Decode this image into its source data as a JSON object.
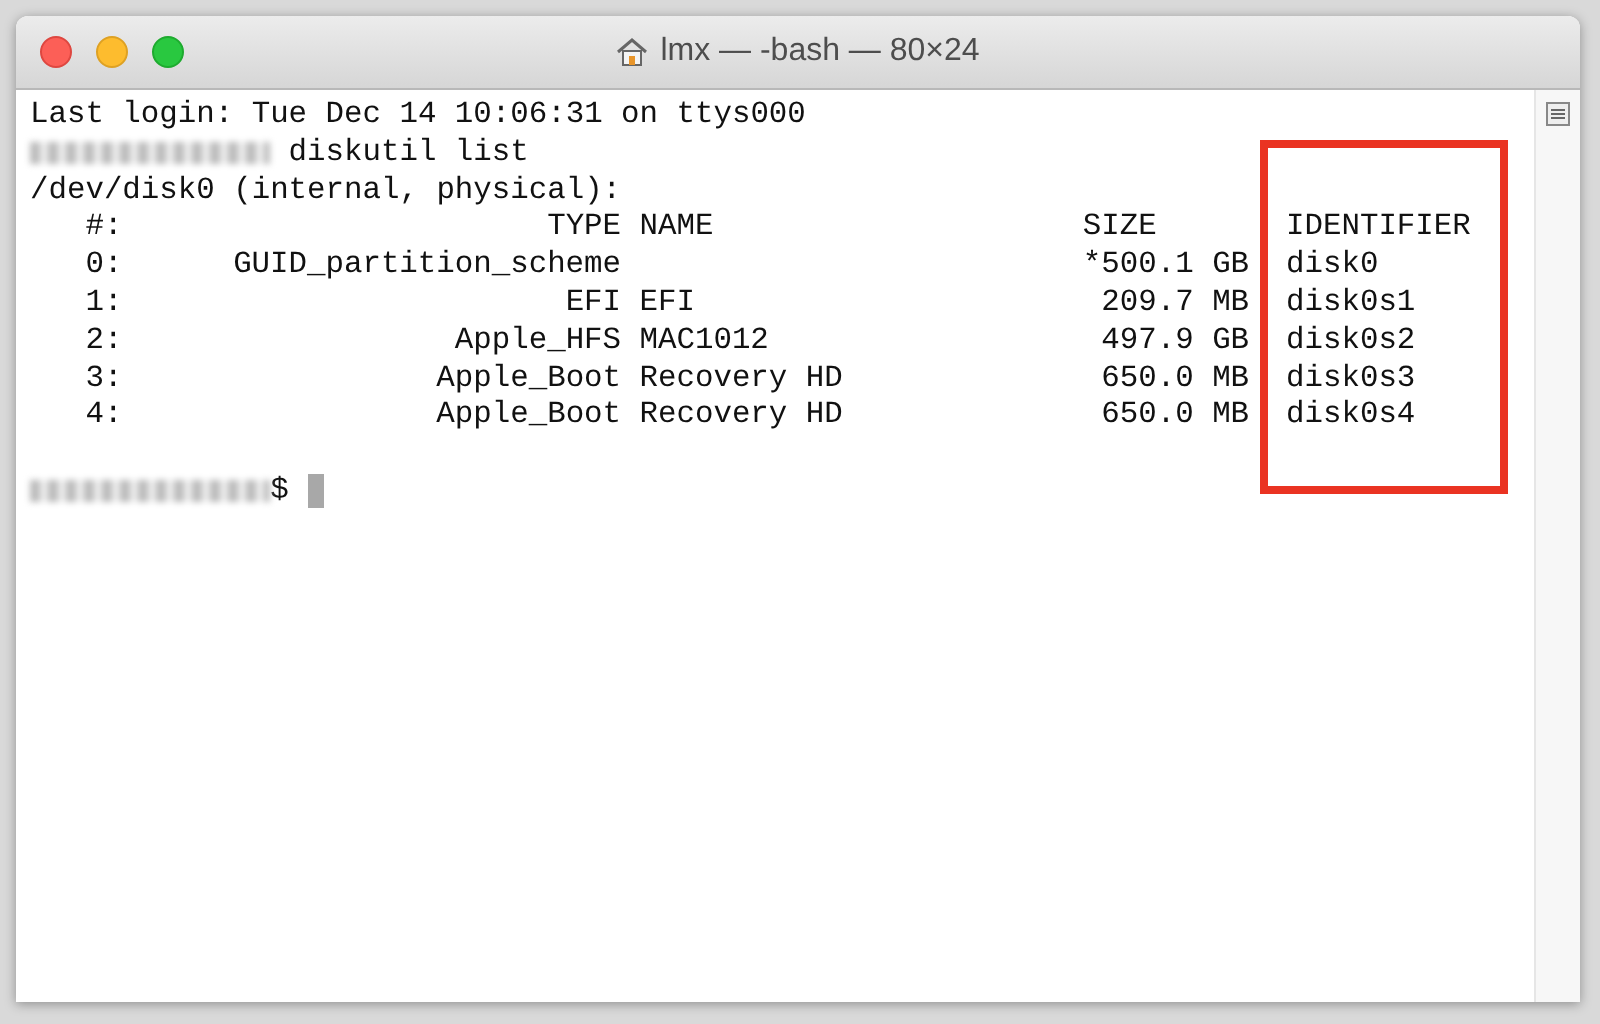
{
  "window": {
    "title": "lmx — -bash — 80×24"
  },
  "terminal": {
    "lines_before": [
      "Last login: Tue Dec 14 10:06:31 on ttys000"
    ],
    "command": {
      "text": " diskutil list"
    },
    "disk_line": "/dev/disk0 (internal, physical):",
    "table": {
      "columns": [
        {
          "label": "#:",
          "highlighted": false
        },
        {
          "label": "TYPE",
          "highlighted": false
        },
        {
          "label": "NAME",
          "highlighted": false
        },
        {
          "label": "SIZE",
          "highlighted": false
        },
        {
          "label": "IDENTIFIER",
          "highlighted": true
        }
      ],
      "rows": [
        [
          "0:",
          "GUID_partition_scheme",
          "",
          "*500.1 GB",
          "disk0"
        ],
        [
          "1:",
          "EFI",
          "EFI",
          "209.7 MB",
          "disk0s1"
        ],
        [
          "2:",
          "Apple_HFS",
          "MAC1012",
          "497.9 GB",
          "disk0s2"
        ],
        [
          "3:",
          "Apple_Boot",
          "Recovery HD",
          "650.0 MB",
          "disk0s3"
        ],
        [
          "4:",
          "Apple_Boot",
          "Recovery HD",
          "650.0 MB",
          "disk0s4"
        ]
      ]
    },
    "prompt": "$"
  }
}
